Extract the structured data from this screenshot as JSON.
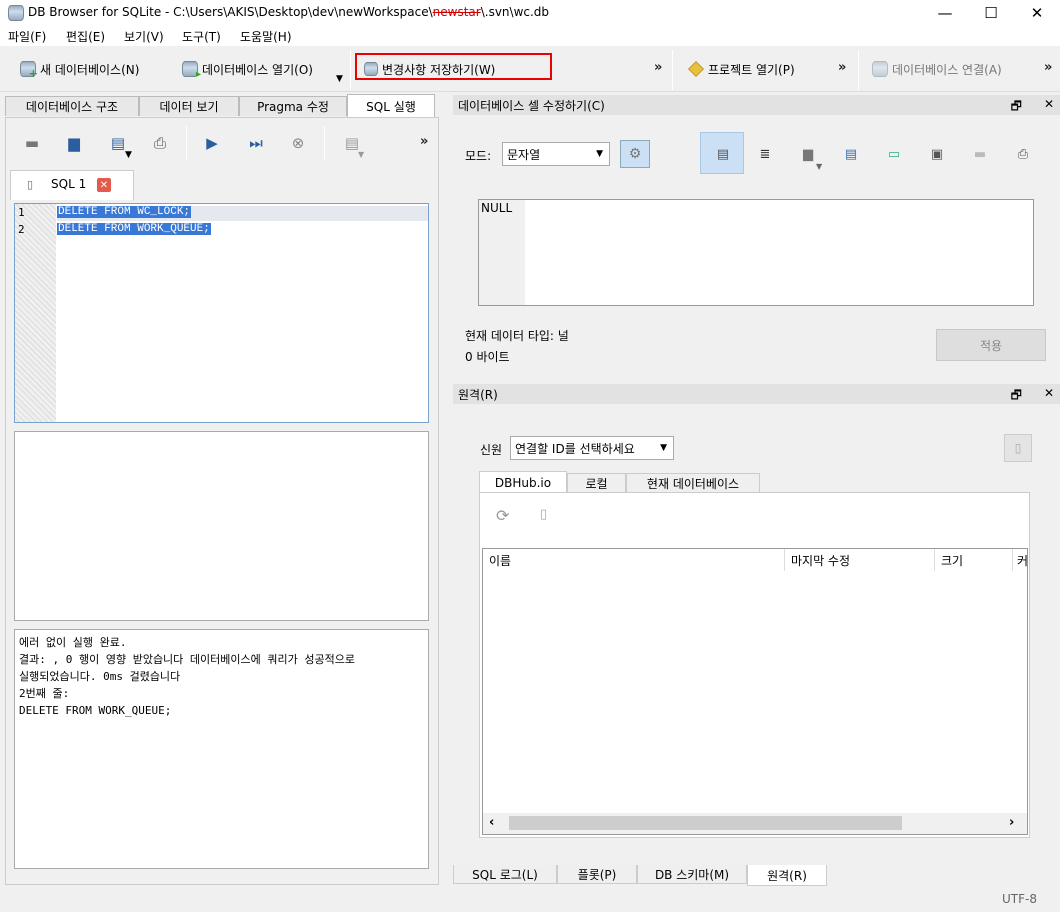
{
  "window": {
    "title_prefix": "DB Browser for SQLite - C:\\Users\\AKIS\\Desktop\\dev\\newWorkspace\\",
    "title_redacted": "newstar",
    "title_suffix": "\\.svn\\wc.db",
    "minimize": "—",
    "maximize": "☐",
    "close": "✕"
  },
  "menu": [
    "파일(F)",
    "편집(E)",
    "보기(V)",
    "도구(T)",
    "도움말(H)"
  ],
  "toolbar": {
    "new_db": "새 데이터베이스(N)",
    "open_db": "데이터베이스 열기(O)",
    "write_changes": "변경사항 저장하기(W)",
    "open_project": "프로젝트 열기(P)",
    "attach_db": "데이터베이스 연결(A)",
    "overflow": "»"
  },
  "left_tabs": [
    "데이터베이스 구조",
    "데이터 보기",
    "Pragma 수정",
    "SQL 실행"
  ],
  "sql_tab": {
    "label": "SQL 1"
  },
  "editor": {
    "lines": [
      {
        "no": "1",
        "code": "DELETE FROM WC_LOCK;"
      },
      {
        "no": "2",
        "code": "DELETE FROM WORK_QUEUE;"
      }
    ]
  },
  "message": {
    "lines": [
      "에러 없이 실행 완료.",
      "결과: , 0 행이 영향 받았습니다 데이터베이스에 쿼리가 성공적으로",
      "실행되었습니다. 0ms 걸렸습니다",
      "2번째 줄:",
      "DELETE FROM WORK_QUEUE;"
    ]
  },
  "edit_cell": {
    "title": "데이터베이스 셀 수정하기(C)",
    "mode_label": "모드:",
    "mode_value": "문자열",
    "value": "NULL",
    "type_label": "현재 데이터 타입: 널",
    "size_label": "0 바이트",
    "apply": "적용"
  },
  "remote": {
    "title": "원격(R)",
    "identity_label": "신원",
    "identity_value": "연결할 ID를 선택하세요",
    "tabs": [
      "DBHub.io",
      "로컬",
      "현재 데이터베이스"
    ],
    "columns": [
      "이름",
      "마지막 수정",
      "크기",
      "커"
    ]
  },
  "bottom_tabs": [
    "SQL 로그(L)",
    "플롯(P)",
    "DB 스키마(M)",
    "원격(R)"
  ],
  "status": {
    "encoding": "UTF-8"
  },
  "colors": {
    "highlight_box": "#e00000",
    "selection": "#3a78d6"
  }
}
